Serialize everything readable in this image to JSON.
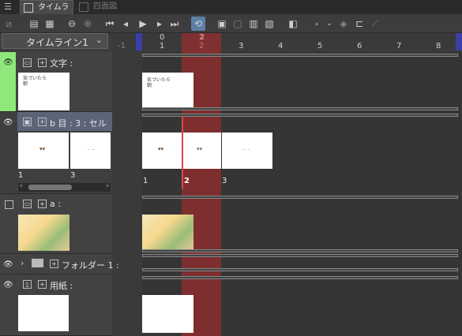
{
  "tabs": [
    {
      "label": "タイムライン",
      "active": true
    },
    {
      "label": "四面図",
      "active": false
    }
  ],
  "timeline_select": {
    "value": "タイムライン1"
  },
  "ruler": {
    "top_marks": [
      "0",
      "2"
    ],
    "frames": [
      "-1",
      "1",
      "2",
      "3",
      "4",
      "5",
      "6",
      "7",
      "8"
    ]
  },
  "layers": [
    {
      "name": "文字 :",
      "visible": true
    },
    {
      "name": "b 目 : 3 : セル",
      "visible": true,
      "cells": [
        "1",
        "3"
      ]
    },
    {
      "name": "a :",
      "visible": false
    },
    {
      "name": "フォルダー 1 :",
      "visible": true
    },
    {
      "name": "用紙 :",
      "visible": true
    }
  ],
  "track_cells": {
    "b_labels": [
      "1",
      "2",
      "3"
    ]
  },
  "thumbnail_text": "気づいたら朝",
  "colors": {
    "accent": "#5d7fa6",
    "current_frame": "#b42828",
    "layer_green": "#8ee87a"
  }
}
